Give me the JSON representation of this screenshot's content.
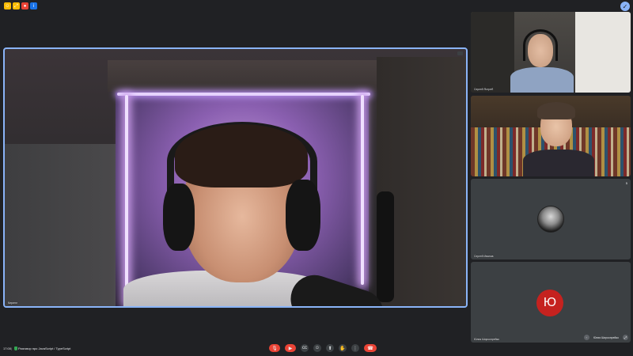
{
  "app": {
    "badge_icon": "check-shield-icon",
    "badge_symbol": "✓"
  },
  "topbar": {
    "icons": [
      {
        "name": "emoji-icon",
        "color": "#fbbc04",
        "symbol": "☺"
      },
      {
        "name": "fullscreen-icon",
        "color": "#fbbc04",
        "symbol": "⤢"
      },
      {
        "name": "record-icon",
        "color": "#ea4335",
        "symbol": "●"
      },
      {
        "name": "info-icon",
        "color": "#1a73e8",
        "symbol": "i"
      }
    ]
  },
  "main_speaker": {
    "name": "Кирилл"
  },
  "participants": [
    {
      "name": "Сергей Ястреб",
      "kind": "video"
    },
    {
      "name": "",
      "kind": "video"
    },
    {
      "name": "Сергей Иванов",
      "kind": "photo",
      "badge": "5"
    },
    {
      "name": "Юлия Ширкопрейко",
      "kind": "letter",
      "letter": "Ю",
      "letter_color": "#c5221f",
      "controls_label": "Юлия Ширкопрейко"
    }
  ],
  "bottombar": {
    "time": "17:00",
    "separator": "|",
    "meeting_title": "Разговор про JavaScript / TypeScript",
    "controls": [
      {
        "name": "mic-icon",
        "symbol": "🎙",
        "style": "wide"
      },
      {
        "name": "camera-icon",
        "symbol": "▶",
        "style": "wide"
      },
      {
        "name": "captions-icon",
        "symbol": "cc",
        "style": ""
      },
      {
        "name": "emoji-reaction-icon",
        "symbol": "☺",
        "style": ""
      },
      {
        "name": "present-icon",
        "symbol": "⬆",
        "style": ""
      },
      {
        "name": "raise-hand-icon",
        "symbol": "✋",
        "style": ""
      },
      {
        "name": "more-icon",
        "symbol": "⋮",
        "style": ""
      }
    ],
    "end_call_symbol": "☎"
  }
}
